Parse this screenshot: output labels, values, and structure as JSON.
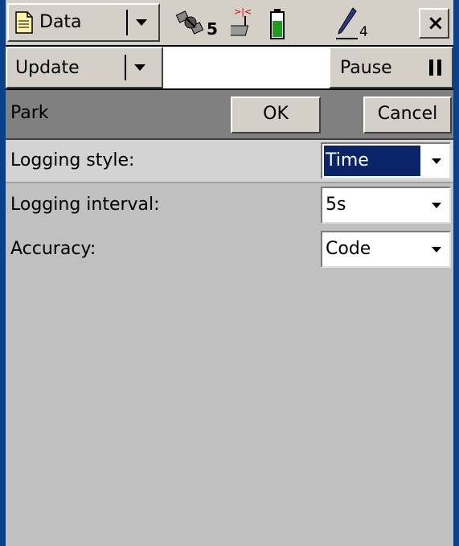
{
  "statusbar": {
    "menu_label": "Data",
    "satellite_count": "5",
    "pen_count": "4",
    "close_label": "×",
    "battery_color": "#1e9a1e"
  },
  "toolbar": {
    "update_label": "Update",
    "pause_label": "Pause"
  },
  "form": {
    "title": "Park",
    "ok_label": "OK",
    "cancel_label": "Cancel"
  },
  "fields": [
    {
      "label": "Logging style:",
      "value": "Time"
    },
    {
      "label": "Logging interval:",
      "value": "5s"
    },
    {
      "label": "Accuracy:",
      "value": "Code"
    }
  ],
  "colors": {
    "selection": "#0a246a",
    "background": "#c0c0c0",
    "frame": "#0a3f8a"
  }
}
